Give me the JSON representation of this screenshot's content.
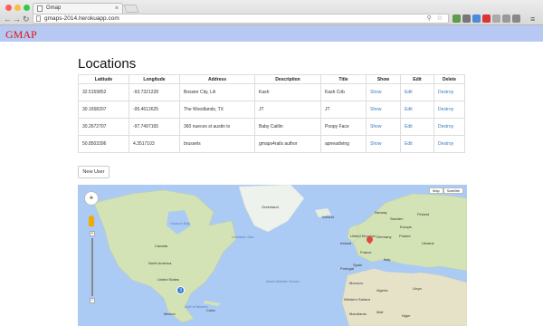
{
  "browser": {
    "tab_title": "Gmap",
    "tab_close": "×",
    "url": "gmaps-2014.herokuapp.com",
    "back": "←",
    "forward": "→",
    "reload": "↻",
    "menu": "≡",
    "url_icons": "⚲ ☆"
  },
  "app": {
    "brand": "GMAP"
  },
  "page": {
    "title": "Locations",
    "headers": [
      "Latitude",
      "Longitude",
      "Address",
      "Description",
      "Title",
      "Show",
      "Edit",
      "Delete"
    ],
    "rows": [
      {
        "latitude": "32.5159852",
        "longitude": "-93.7321228",
        "address": "Bossier City, LA",
        "description": "Kash",
        "title": "Kash Crib",
        "show": "Show",
        "edit": "Edit",
        "destroy": "Destroy"
      },
      {
        "latitude": "30.1658207",
        "longitude": "-95.4612625",
        "address": "The Woodlands, TX",
        "description": "JT",
        "title": "JT",
        "show": "Show",
        "edit": "Edit",
        "destroy": "Destroy"
      },
      {
        "latitude": "30.2672707",
        "longitude": "-97.7497165",
        "address": "360 nueces st austin tx",
        "description": "Baby Caitlin",
        "title": "Poopy Face",
        "show": "Show",
        "edit": "Edit",
        "destroy": "Destroy"
      },
      {
        "latitude": "50.8503396",
        "longitude": "4.3517103",
        "address": "brussels",
        "description": "gmaps4rails author",
        "title": "apneadiving",
        "show": "Show",
        "edit": "Edit",
        "destroy": "Destroy"
      }
    ],
    "new_user_button": "New User"
  },
  "map": {
    "map_button": "Map",
    "satellite_button": "Satellite",
    "zoom_in": "+",
    "zoom_out": "−",
    "cluster_count": "3",
    "labels": {
      "greenland": "Greenland",
      "canada": "Canada",
      "north_america": "North America",
      "united_states": "United States",
      "mexico": "Mexico",
      "cuba": "Cuba",
      "north_atlantic": "North Atlantic Ocean",
      "europe": "Europe",
      "france": "France",
      "spain": "Spain",
      "portugal": "Portugal",
      "morocco": "Morocco",
      "algeria": "Algeria",
      "libya": "Libya",
      "mali": "Mali",
      "niger": "Niger",
      "sweden": "Sweden",
      "finland": "Finland",
      "norway": "Norway",
      "iceland": "Iceland",
      "italy": "Italy",
      "germany": "Germany",
      "poland": "Poland",
      "ukraine": "Ukraine",
      "hudson_bay": "Hudson Bay",
      "gulf_of_mexico": "Gulf of Mexico",
      "western_sahara": "Western Sahara",
      "sea_of_labrador": "Labrador Sea",
      "mauritania": "Mauritania",
      "united_kingdom": "United Kingdom",
      "ireland": "Ireland"
    }
  },
  "colors": {
    "brand": "#dd1111",
    "navbar": "#b7c9f3",
    "link": "#3b7bbf",
    "ocean": "#abcbf5",
    "land": "#d4e3b5",
    "pin": "#e4453c",
    "cluster": "#2e7ad8"
  }
}
